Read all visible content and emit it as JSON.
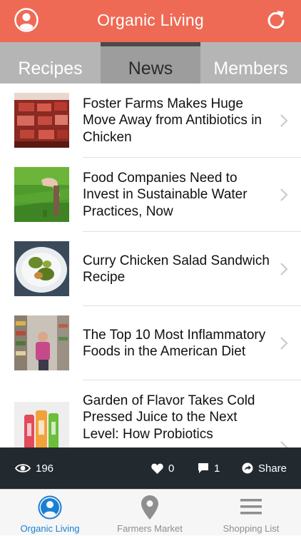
{
  "header": {
    "title": "Organic Living",
    "avatar_icon": "user-icon",
    "refresh_icon": "refresh-icon",
    "color": "#ef6a55"
  },
  "tabs": [
    {
      "label": "Recipes",
      "selected": false
    },
    {
      "label": "News",
      "selected": true
    },
    {
      "label": "Members",
      "selected": false
    }
  ],
  "news": [
    {
      "title": "Foster Farms Makes Huge Move Away from Antibiotics in Chicken",
      "thumb": "raw chicken on tray"
    },
    {
      "title": "Food Companies Need to Invest in Sustainable Water Practices, Now",
      "thumb": "hand watering grass"
    },
    {
      "title": "Curry Chicken Salad Sandwich Recipe",
      "thumb": "plate of salad"
    },
    {
      "title": "The Top 10 Most Inflammatory Foods in the American Diet",
      "thumb": "grocery aisle shopper"
    },
    {
      "title": "Garden of Flavor Takes Cold Pressed Juice to the Next Level: How Probiotics",
      "thumb": "juice bottles"
    }
  ],
  "actions": {
    "views": "196",
    "likes": "0",
    "comments": "1",
    "share": "Share"
  },
  "tabbar": [
    {
      "label": "Organic Living",
      "icon": "user-circle-icon",
      "active": true
    },
    {
      "label": "Farmers Market",
      "icon": "map-pin-icon",
      "active": false
    },
    {
      "label": "Shopping List",
      "icon": "list-icon",
      "active": false
    }
  ]
}
